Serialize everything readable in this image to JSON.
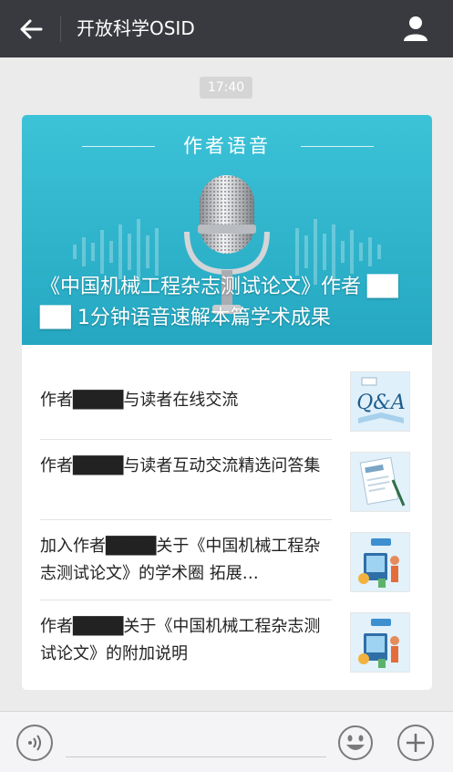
{
  "header": {
    "title": "开放科学OSID",
    "back_icon": "arrow-left-icon",
    "profile_icon": "user-icon"
  },
  "timestamp": "17:40",
  "card": {
    "banner_label": "作者语音",
    "banner_title": "《中国机械工程杂志测试论文》作者 ██ ██ 1分钟语音速解本篇学术成果",
    "items": [
      {
        "text": "作者████与读者在线交流"
      },
      {
        "text": "作者████与读者互动交流精选问答集"
      },
      {
        "text": "加入作者████关于《中国机械工程杂志测试论文》的学术圈 拓展…"
      },
      {
        "text": "作者████关于《中国机械工程杂志测试论文》的附加说明"
      }
    ]
  },
  "colors": {
    "topbar": "#393a3f",
    "banner": "#2fb5cd",
    "background": "#ebebeb"
  },
  "input_bar": {
    "voice_icon": "voice-icon",
    "emoji_icon": "emoji-icon",
    "plus_icon": "plus-icon"
  }
}
